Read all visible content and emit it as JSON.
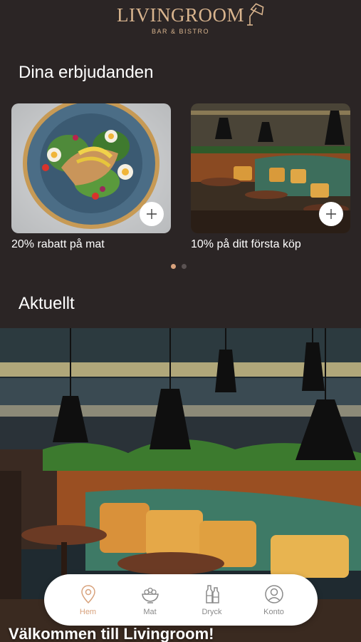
{
  "logo": {
    "name": "LIVINGROOM",
    "tagline": "BAR & BISTRO"
  },
  "offers": {
    "title": "Dina erbjudanden",
    "items": [
      {
        "label": "20% rabatt på mat"
      },
      {
        "label": "10% på ditt första köp"
      }
    ],
    "pager": {
      "count": 2,
      "active": 0
    }
  },
  "news": {
    "title": "Aktuellt",
    "caption": "Välkommen till Livingroom!"
  },
  "tabbar": {
    "items": [
      {
        "label": "Hem",
        "icon": "location-pin-icon",
        "active": true
      },
      {
        "label": "Mat",
        "icon": "salad-bowl-icon",
        "active": false
      },
      {
        "label": "Dryck",
        "icon": "bottles-icon",
        "active": false
      },
      {
        "label": "Konto",
        "icon": "user-icon",
        "active": false
      }
    ]
  },
  "colors": {
    "background": "#2b2525",
    "accent": "#d8a27c",
    "logo": "#d8b48e",
    "tab_inactive": "#8a8a8a"
  }
}
